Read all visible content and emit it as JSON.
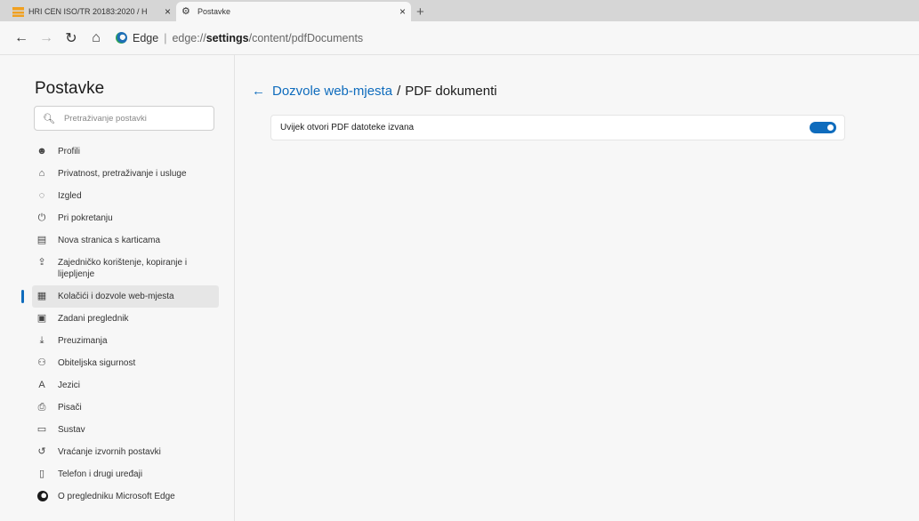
{
  "tabs": [
    {
      "title": "HRI CEN ISO/TR 20183:2020 / H",
      "active": false
    },
    {
      "title": "Postavke",
      "active": true
    }
  ],
  "tab_close": "×",
  "new_tab": "+",
  "address": {
    "site_label": "Edge",
    "separator": "|",
    "url_prefix": "edge://",
    "url_host": "settings",
    "url_path": "/content/pdfDocuments"
  },
  "sidebar": {
    "title": "Postavke",
    "search_placeholder": "Pretraživanje postavki",
    "items": [
      {
        "label": "Profili",
        "icon": "profile-icon",
        "glyph": "☻"
      },
      {
        "label": "Privatnost, pretraživanje i usluge",
        "icon": "lock-icon",
        "glyph": "⌂"
      },
      {
        "label": "Izgled",
        "icon": "palette-icon",
        "glyph": "◌"
      },
      {
        "label": "Pri pokretanju",
        "icon": "power-icon",
        "glyph": "⏻"
      },
      {
        "label": "Nova stranica s karticama",
        "icon": "new-tab-page-icon",
        "glyph": "▤"
      },
      {
        "label": "Zajedničko korištenje, kopiranje i lijepljenje",
        "icon": "share-icon",
        "glyph": "⇪"
      },
      {
        "label": "Kolačići i dozvole web-mjesta",
        "icon": "cookies-icon",
        "glyph": "▦",
        "active": true
      },
      {
        "label": "Zadani preglednik",
        "icon": "default-browser-icon",
        "glyph": "▣"
      },
      {
        "label": "Preuzimanja",
        "icon": "download-icon",
        "glyph": "⤓"
      },
      {
        "label": "Obiteljska sigurnost",
        "icon": "family-icon",
        "glyph": "⚇"
      },
      {
        "label": "Jezici",
        "icon": "languages-icon",
        "glyph": "A"
      },
      {
        "label": "Pisači",
        "icon": "printer-icon",
        "glyph": "⎙"
      },
      {
        "label": "Sustav",
        "icon": "system-icon",
        "glyph": "▭"
      },
      {
        "label": "Vraćanje izvornih postavki",
        "icon": "reset-icon",
        "glyph": "↺"
      },
      {
        "label": "Telefon i drugi uređaji",
        "icon": "phone-icon",
        "glyph": "▯"
      },
      {
        "label": "O pregledniku Microsoft Edge",
        "icon": "edge-logo-icon",
        "glyph": ""
      }
    ]
  },
  "content": {
    "breadcrumb_parent": "Dozvole web-mjesta",
    "breadcrumb_sep": "/",
    "breadcrumb_current": "PDF dokumenti",
    "setting_label": "Uvijek otvori PDF datoteke izvana",
    "setting_enabled": true
  },
  "colors": {
    "accent": "#0f6cbd"
  }
}
